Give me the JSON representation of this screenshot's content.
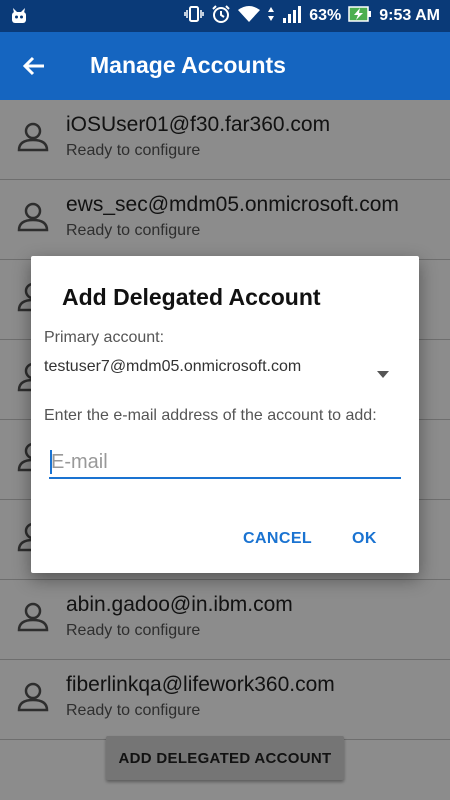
{
  "status_bar": {
    "battery": "63%",
    "time": "9:53 AM"
  },
  "app_bar": {
    "title": "Manage Accounts"
  },
  "accounts": [
    {
      "email": "iOSUser01@f30.far360.com",
      "status": "Ready to configure"
    },
    {
      "email": "ews_sec@mdm05.onmicrosoft.com",
      "status": "Ready to configure"
    },
    {
      "email": "",
      "status": ""
    },
    {
      "email": "",
      "status": ""
    },
    {
      "email": "",
      "status": ""
    },
    {
      "email": "",
      "status": ""
    },
    {
      "email": "abin.gadoo@in.ibm.com",
      "status": "Ready to configure"
    },
    {
      "email": "fiberlinkqa@lifework360.com",
      "status": "Ready to configure"
    }
  ],
  "bottom_button": {
    "label": "ADD DELEGATED ACCOUNT"
  },
  "dialog": {
    "title": "Add Delegated Account",
    "primary_label": "Primary account:",
    "primary_value": "testuser7@mdm05.onmicrosoft.com",
    "email_label": "Enter the e-mail address of the account to add:",
    "email_placeholder": "E-mail",
    "email_value": "",
    "cancel_label": "CANCEL",
    "ok_label": "OK"
  },
  "colors": {
    "status_bar": "#0a3a78",
    "app_bar": "#1565c0",
    "accent": "#1a73d1",
    "battery": "#4caf50"
  }
}
